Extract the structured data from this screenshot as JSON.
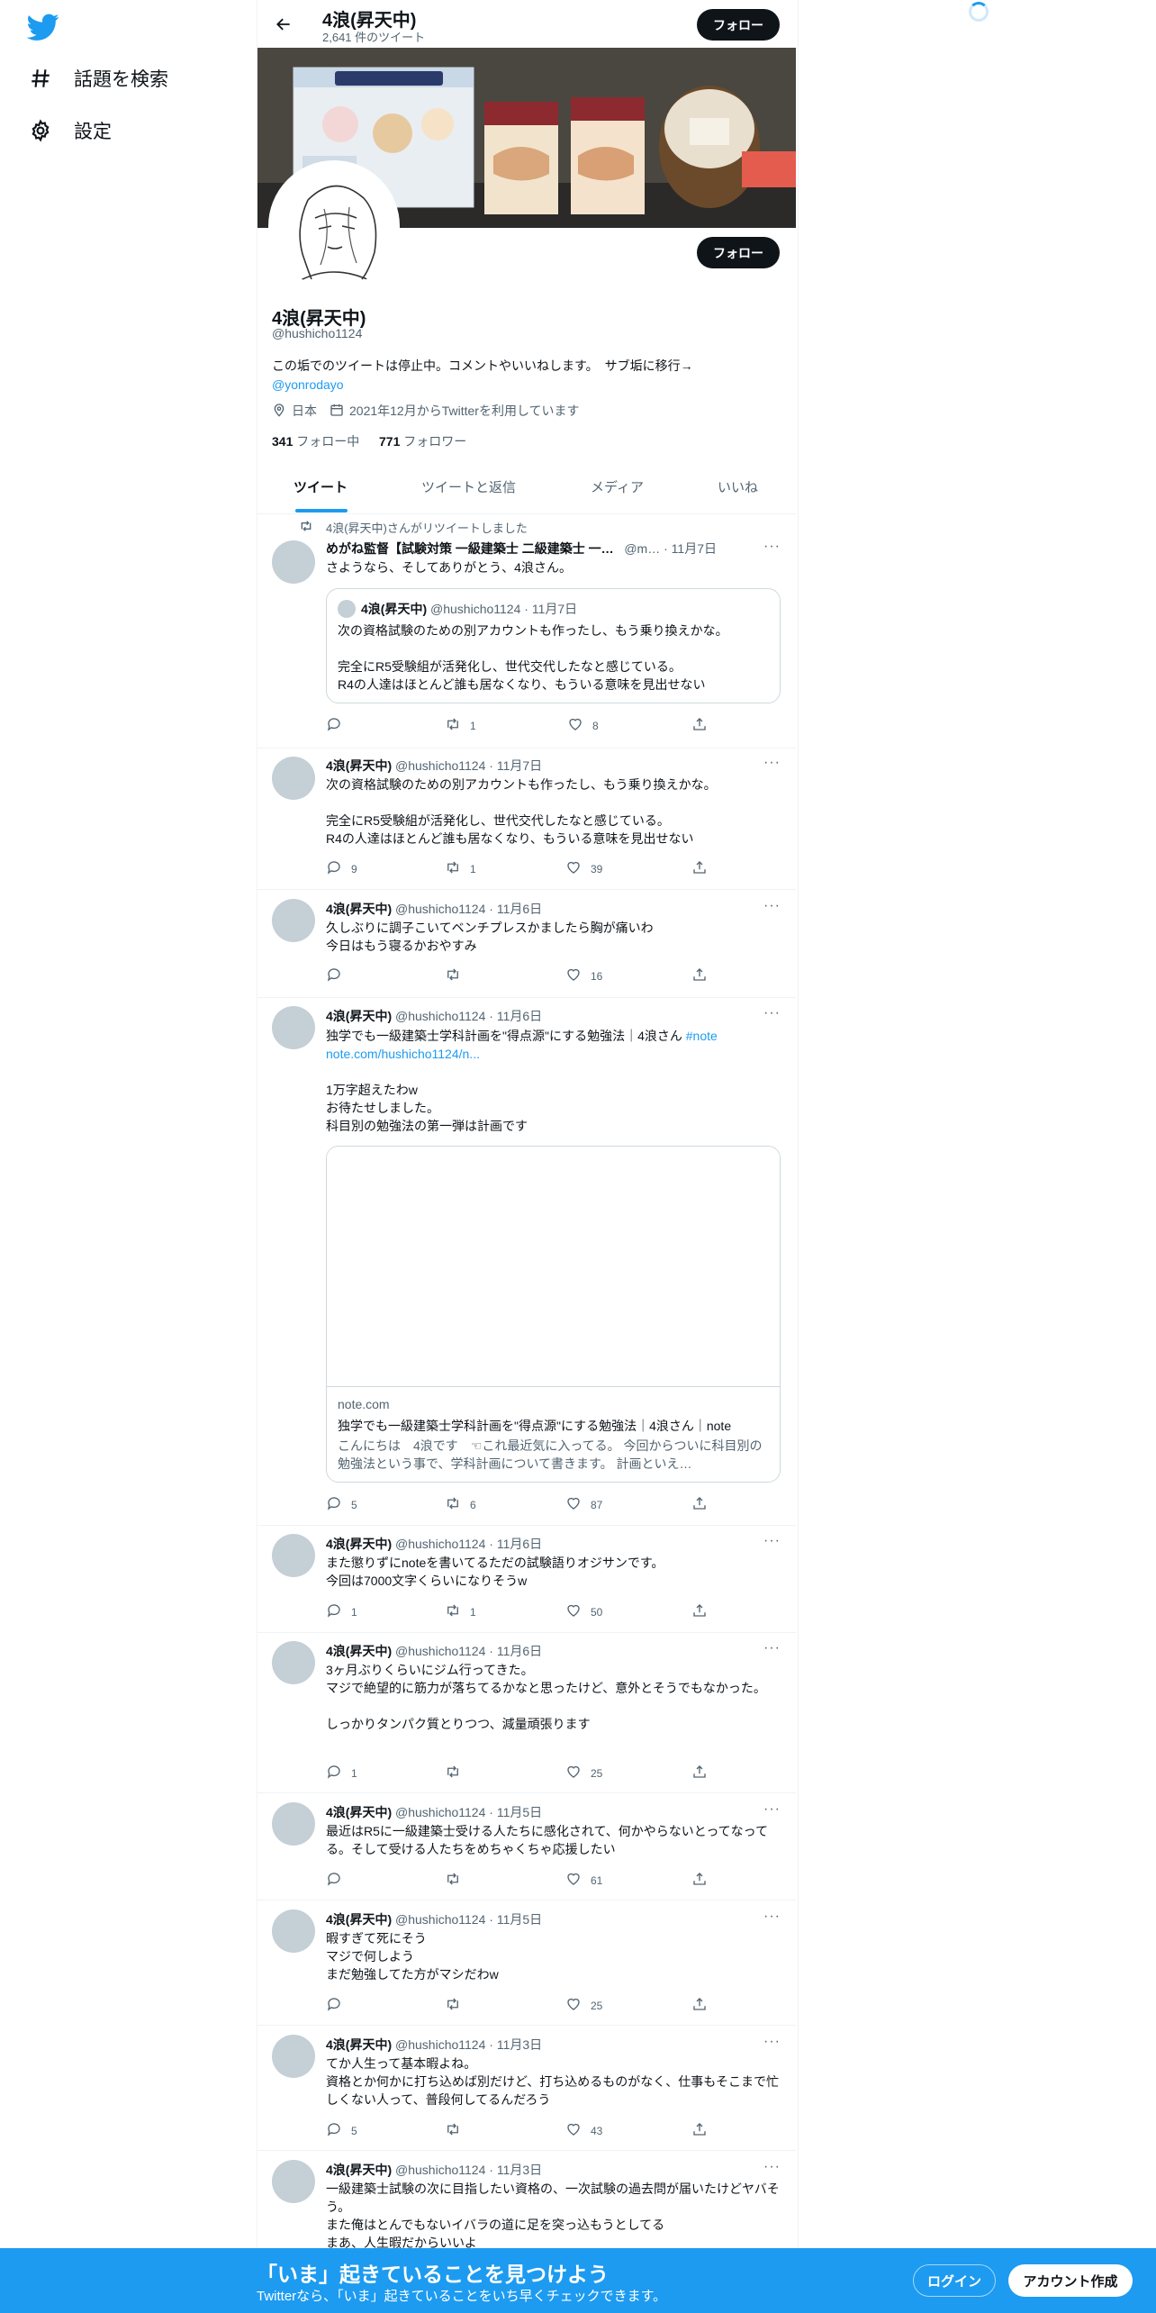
{
  "sidebar": {
    "logo_icon": "twitter-bird-icon",
    "items": [
      {
        "label": "話題を検索",
        "icon": "hashtag-icon"
      },
      {
        "label": "設定",
        "icon": "gear-icon"
      }
    ]
  },
  "header": {
    "name": "4浪(昇天中)",
    "tweet_count": "2,641 件のツイート",
    "follow_label": "フォロー"
  },
  "profile": {
    "name": "4浪(昇天中)",
    "handle": "@hushicho1124",
    "bio": "この垢でのツイートは停止中。コメントやいいねします。　サブ垢に移行→",
    "bio_link": "@yonrodayo",
    "location": "日本",
    "joined": "2021年12月からTwitterを利用しています",
    "following_count": "341",
    "following_label": "フォロー中",
    "followers_count": "771",
    "followers_label": "フォロワー",
    "follow_label": "フォロー"
  },
  "tabs": [
    "ツイート",
    "ツイートと返信",
    "メディア",
    "いいね"
  ],
  "retweet_note": "4浪(昇天中)さんがリツイートしました",
  "tweets": [
    {
      "name": "めがね監督【試験対策 一級建築士 二級建築士 一…",
      "handle": "@m…",
      "date": "11月7日",
      "text": "さようなら、そしてありがとう、4浪さん。",
      "quote": {
        "name": "4浪(昇天中)",
        "handle": "@hushicho1124",
        "date": "11月7日",
        "text": "次の資格試験のための別アカウントも作ったし、もう乗り換えかな。\n\n完全にR5受験組が活発化し、世代交代したなと感じている。\nR4の人達はほとんど誰も居なくなり、もういる意味を見出せない"
      },
      "replies": "",
      "retweets": "1",
      "likes": "8"
    },
    {
      "name": "4浪(昇天中)",
      "handle": "@hushicho1124",
      "date": "11月7日",
      "text": "次の資格試験のための別アカウントも作ったし、もう乗り換えかな。\n\n完全にR5受験組が活発化し、世代交代したなと感じている。\nR4の人達はほとんど誰も居なくなり、もういる意味を見出せない",
      "replies": "9",
      "retweets": "1",
      "likes": "39"
    },
    {
      "name": "4浪(昇天中)",
      "handle": "@hushicho1124",
      "date": "11月6日",
      "text": "久しぶりに調子こいてベンチプレスかましたら胸が痛いわ\n今日はもう寝るかおやすみ",
      "replies": "",
      "retweets": "",
      "likes": "16"
    },
    {
      "name": "4浪(昇天中)",
      "handle": "@hushicho1124",
      "date": "11月6日",
      "text_pre": "独学でも一級建築士学科計画を\"得点源\"にする勉強法｜4浪さん ",
      "hashtag": "#note",
      "url": "note.com/hushicho1124/n...",
      "text_post": "1万字超えたわw\nお待たせしました。\n科目別の勉強法の第一弾は計画です",
      "card": {
        "domain": "note.com",
        "title": "独学でも一級建築士学科計画を\"得点源\"にする勉強法｜4浪さん｜note",
        "desc": "こんにちは　4浪です　☜これ最近気に入ってる。 今回からついに科目別の勉強法という事で、学科計画について書きます。 計画といえ…"
      },
      "replies": "5",
      "retweets": "6",
      "likes": "87"
    },
    {
      "name": "4浪(昇天中)",
      "handle": "@hushicho1124",
      "date": "11月6日",
      "text": "また懲りずにnoteを書いてるただの試験語りオジサンです。\n今回は7000文字くらいになりそうw",
      "replies": "1",
      "retweets": "1",
      "likes": "50"
    },
    {
      "name": "4浪(昇天中)",
      "handle": "@hushicho1124",
      "date": "11月6日",
      "text": "3ヶ月ぶりくらいにジム行ってきた。\nマジで絶望的に筋力が落ちてるかなと思ったけど、意外とそうでもなかった。\n\nしっかりタンパク質とりつつ、減量頑張ります",
      "replies": "1",
      "retweets": "",
      "likes": "25"
    },
    {
      "name": "4浪(昇天中)",
      "handle": "@hushicho1124",
      "date": "11月5日",
      "text": "最近はR5に一級建築士受ける人たちに感化されて、何かやらないとってなってる。そして受ける人たちをめちゃくちゃ応援したい",
      "replies": "",
      "retweets": "",
      "likes": "61"
    },
    {
      "name": "4浪(昇天中)",
      "handle": "@hushicho1124",
      "date": "11月5日",
      "text": "暇すぎて死にそう\nマジで何しよう\nまだ勉強してた方がマシだわw",
      "replies": "",
      "retweets": "",
      "likes": "25"
    },
    {
      "name": "4浪(昇天中)",
      "handle": "@hushicho1124",
      "date": "11月3日",
      "text": "てか人生って基本暇よね。\n資格とか何かに打ち込めば別だけど、打ち込めるものがなく、仕事もそこまで忙しくない人って、普段何してるんだろう",
      "replies": "5",
      "retweets": "",
      "likes": "43"
    },
    {
      "name": "4浪(昇天中)",
      "handle": "@hushicho1124",
      "date": "11月3日",
      "text": "一級建築士試験の次に目指したい資格の、一次試験の過去問が届いたけどヤバそう。\nまた俺はとんでもないイバラの道に足を突っ込もうとしてる\nまあ、人生暇だからいいよ",
      "replies": "",
      "retweets": "",
      "likes": ""
    }
  ],
  "bottom_bar": {
    "title": "「いま」起きていることを見つけよう",
    "subtitle": "Twitterなら、「いま」起きていることをいち早くチェックできます。",
    "login_label": "ログイン",
    "signup_label": "アカウント作成"
  },
  "colors": {
    "accent": "#1d9bf0",
    "text": "#0f1419",
    "muted": "#536471",
    "border": "#eff3f4"
  }
}
